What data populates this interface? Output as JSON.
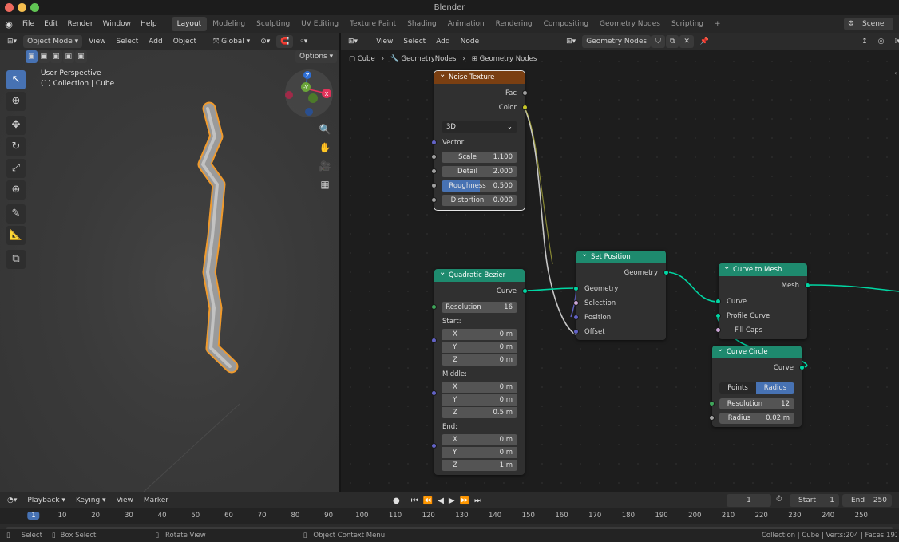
{
  "window": {
    "title": "Blender"
  },
  "menu": [
    "File",
    "Edit",
    "Render",
    "Window",
    "Help"
  ],
  "workspaces": [
    {
      "label": "Layout",
      "active": true
    },
    {
      "label": "Modeling"
    },
    {
      "label": "Sculpting"
    },
    {
      "label": "UV Editing"
    },
    {
      "label": "Texture Paint"
    },
    {
      "label": "Shading"
    },
    {
      "label": "Animation"
    },
    {
      "label": "Rendering"
    },
    {
      "label": "Compositing"
    },
    {
      "label": "Geometry Nodes"
    },
    {
      "label": "Scripting"
    },
    {
      "label": "+"
    }
  ],
  "scene": "Scene",
  "viewport": {
    "mode": "Object Mode",
    "menu": [
      "View",
      "Select",
      "Add",
      "Object"
    ],
    "transform_orientation": "Global",
    "options_label": "Options",
    "overlay_line1": "User Perspective",
    "overlay_line2": "(1) Collection | Cube",
    "gizmo": {
      "z": "Z",
      "y": "-Y",
      "x": "X"
    }
  },
  "node_editor": {
    "menu": [
      "View",
      "Select",
      "Add",
      "Node"
    ],
    "tree_type": "Geometry Nodes",
    "breadcrumb": [
      "Cube",
      "GeometryNodes",
      "Geometry Nodes"
    ],
    "nodes": {
      "noise": {
        "title": "Noise Texture",
        "out_fac": "Fac",
        "out_color": "Color",
        "dimensions": "3D",
        "in_vector": "Vector",
        "fields": [
          {
            "label": "Scale",
            "value": "1.100"
          },
          {
            "label": "Detail",
            "value": "2.000"
          },
          {
            "label": "Roughness",
            "value": "0.500"
          },
          {
            "label": "Distortion",
            "value": "0.000"
          }
        ],
        "roughness_fill": 0.5
      },
      "bezier": {
        "title": "Quadratic Bezier",
        "out_curve": "Curve",
        "resolution": {
          "label": "Resolution",
          "value": "16"
        },
        "start": {
          "label": "Start:",
          "x": "0 m",
          "y": "0 m",
          "z": "0 m"
        },
        "middle": {
          "label": "Middle:",
          "x": "0 m",
          "y": "0 m",
          "z": "0.5 m"
        },
        "end": {
          "label": "End:",
          "x": "0 m",
          "y": "0 m",
          "z": "1 m"
        },
        "axis": {
          "x": "X",
          "y": "Y",
          "z": "Z"
        }
      },
      "setpos": {
        "title": "Set Position",
        "out_geometry": "Geometry",
        "inputs": [
          "Geometry",
          "Selection",
          "Position",
          "Offset"
        ]
      },
      "c2m": {
        "title": "Curve to Mesh",
        "out_mesh": "Mesh",
        "inputs": [
          "Curve",
          "Profile Curve",
          "Fill Caps"
        ]
      },
      "circle": {
        "title": "Curve Circle",
        "out_curve": "Curve",
        "mode_points": "Points",
        "mode_radius": "Radius",
        "resolution": {
          "label": "Resolution",
          "value": "12"
        },
        "radius": {
          "label": "Radius",
          "value": "0.02 m"
        }
      }
    }
  },
  "timeline": {
    "menu": [
      "Playback",
      "Keying",
      "View",
      "Marker"
    ],
    "current_frame": "1",
    "start_label": "Start",
    "start": "1",
    "end_label": "End",
    "end": "250",
    "ruler": [
      "1",
      "10",
      "20",
      "30",
      "40",
      "50",
      "60",
      "70",
      "80",
      "90",
      "100",
      "110",
      "120",
      "130",
      "140",
      "150",
      "160",
      "170",
      "180",
      "190",
      "200",
      "210",
      "220",
      "230",
      "240",
      "250"
    ]
  },
  "status": {
    "select": "Select",
    "box_select": "Box Select",
    "rotate": "Rotate View",
    "context": "Object Context Menu",
    "stats": "Collection | Cube | Verts:204 | Faces:192"
  },
  "colors": {
    "geometry_header": "#1e8a6e",
    "texture_header": "#7a3f12",
    "accent": "#4772b3"
  }
}
